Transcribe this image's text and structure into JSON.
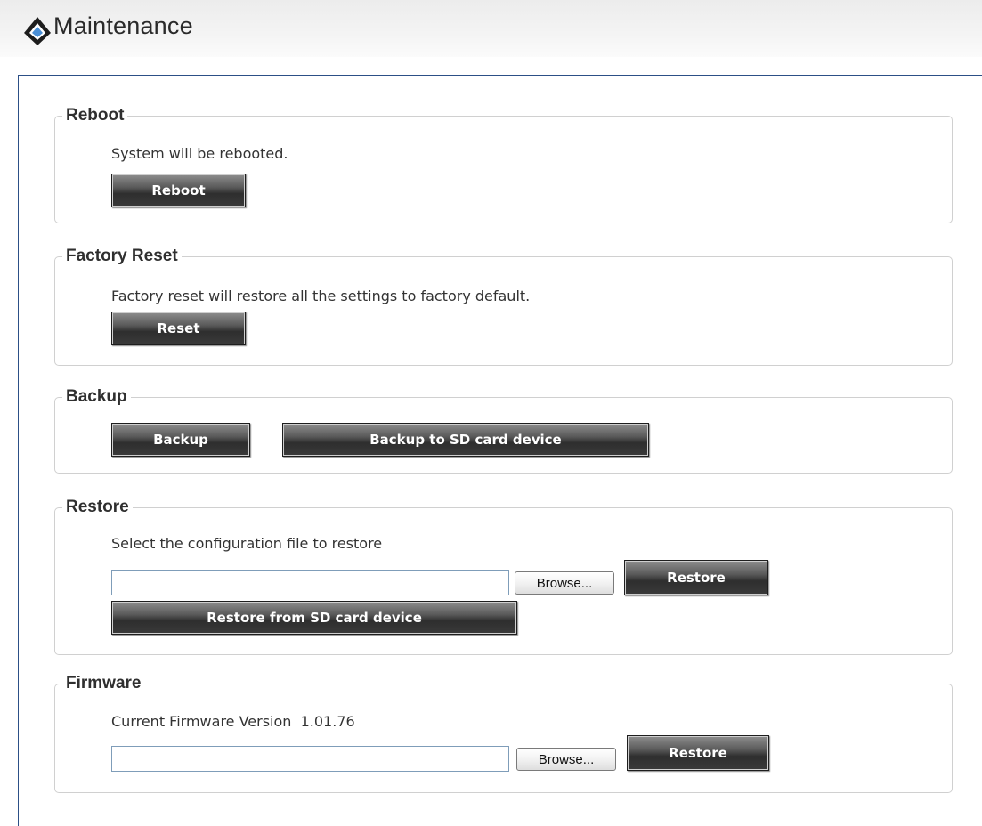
{
  "header": {
    "title": "Maintenance",
    "icon": "diamond-logo-icon"
  },
  "sections": {
    "reboot": {
      "legend": "Reboot",
      "description": "System will be rebooted.",
      "button": "Reboot"
    },
    "factory_reset": {
      "legend": "Factory Reset",
      "description": "Factory reset will restore all the settings to factory default.",
      "button": "Reset"
    },
    "backup": {
      "legend": "Backup",
      "button": "Backup",
      "sd_button": "Backup to SD card device"
    },
    "restore": {
      "legend": "Restore",
      "description": "Select the configuration file to restore",
      "file_value": "",
      "browse": "Browse...",
      "button": "Restore",
      "sd_button": "Restore from SD card device"
    },
    "firmware": {
      "legend": "Firmware",
      "version_label": "Current Firmware Version",
      "version": "1.01.76",
      "file_value": "",
      "browse": "Browse...",
      "button": "Restore"
    }
  },
  "colors": {
    "panel_border": "#2c4f86",
    "button_dark": "#3a3a3a",
    "fieldset_border": "#d0d0d0"
  }
}
